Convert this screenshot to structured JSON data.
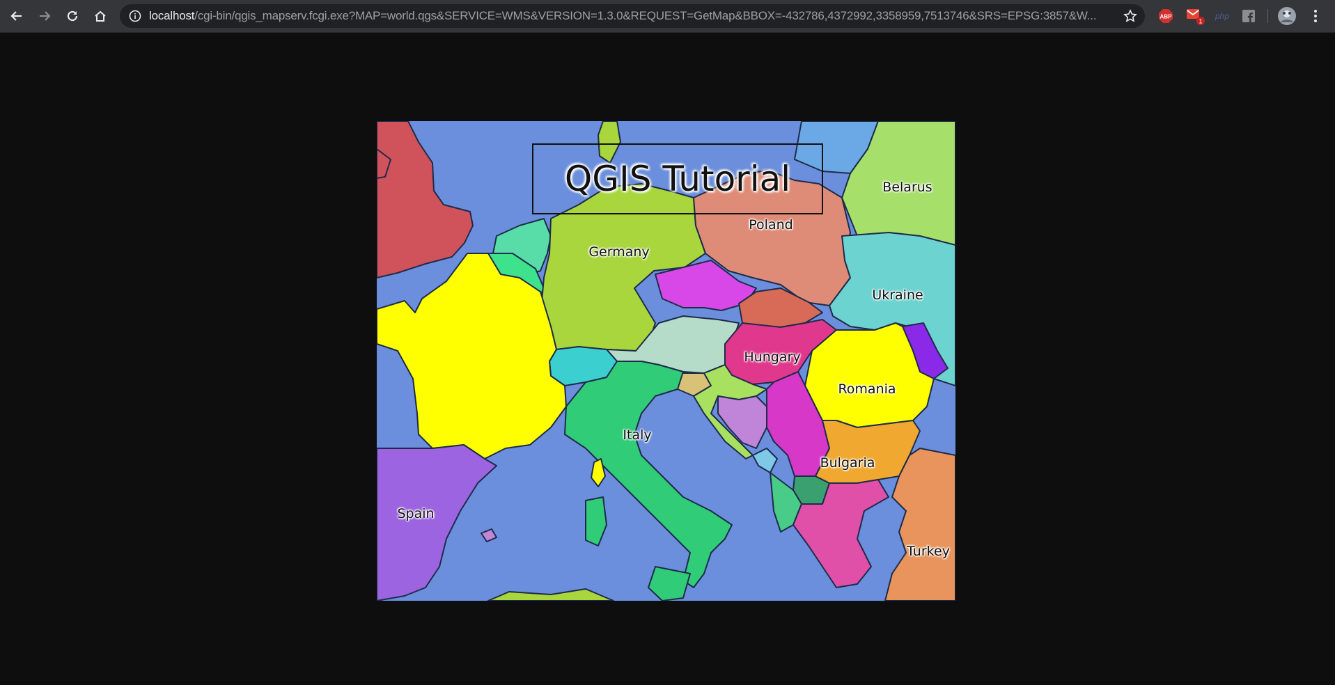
{
  "browser": {
    "url_host": "localhost",
    "url_rest": "/cgi-bin/qgis_mapserv.fcgi.exe?MAP=world.qgs&SERVICE=WMS&VERSION=1.3.0&REQUEST=GetMap&BBOX=-432786,4372992,3358959,7513746&SRS=EPSG:3857&W...",
    "extensions": {
      "abp_label": "ABP",
      "gmail_badge": "1",
      "php_label": "php"
    },
    "icons": [
      "back-icon",
      "forward-icon",
      "reload-icon",
      "home-icon",
      "info-icon",
      "star-icon",
      "adblock-icon",
      "gmail-icon",
      "php-icon",
      "facebook-icon",
      "profile-avatar",
      "more-menu-icon"
    ]
  },
  "map": {
    "title": "QGIS Tutorial",
    "labels": {
      "belarus": "Belarus",
      "poland": "Poland",
      "germany": "Germany",
      "ukraine": "Ukraine",
      "hungary": "Hungary",
      "romania": "Romania",
      "italy": "Italy",
      "bulgaria": "Bulgaria",
      "spain": "Spain",
      "turkey": "Turkey"
    },
    "colors": {
      "sea": "#6b8fdc",
      "france": "#ffff00",
      "germany": "#a8d63c",
      "poland": "#de8c78",
      "belarus": "#a6e06a",
      "ukraine": "#6dd3d0",
      "czechia": "#d848e8",
      "hungary": "#e0388c",
      "romania": "#ffff00",
      "italy": "#30cc78",
      "bulgaria": "#f0a830",
      "spain": "#9c64e0",
      "uk": "#d0525a",
      "turkey": "#e8945c"
    }
  }
}
